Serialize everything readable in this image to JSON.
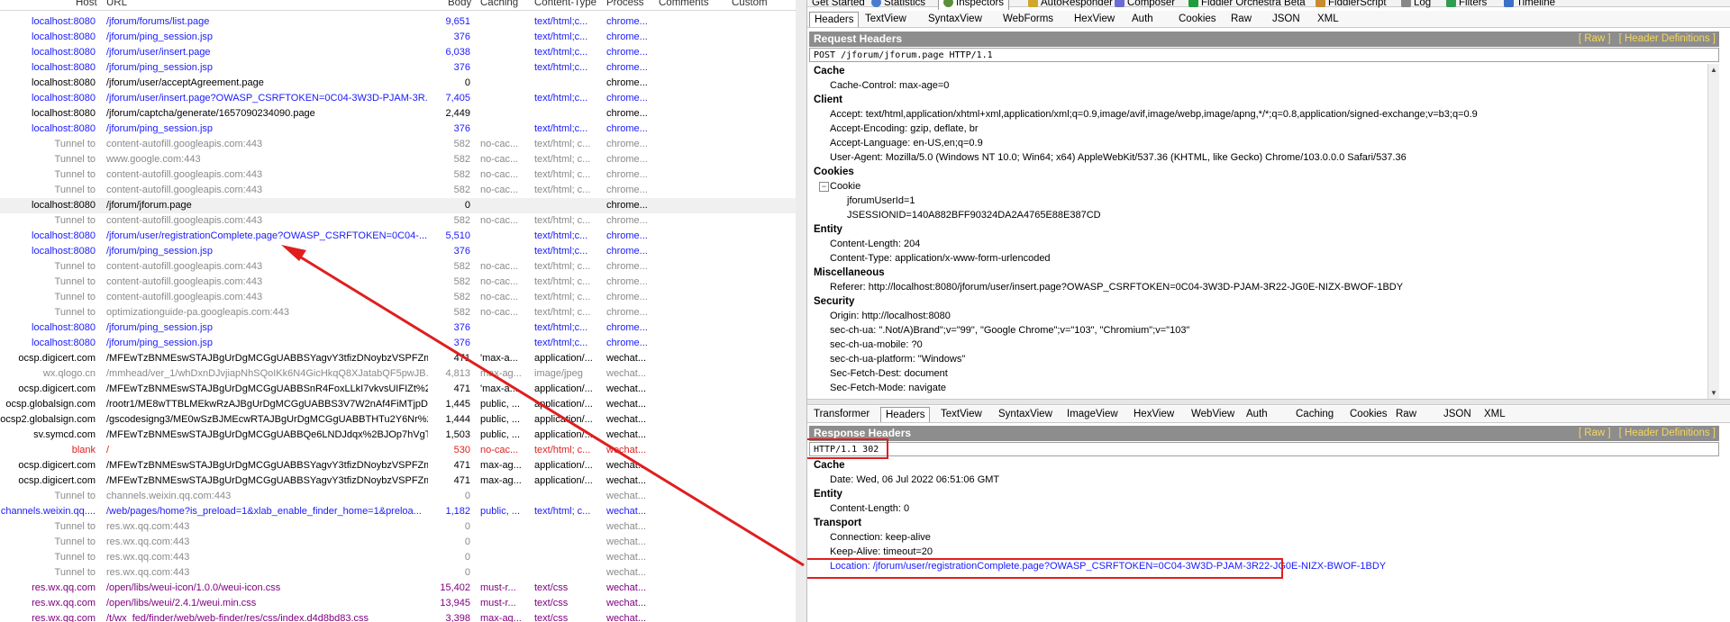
{
  "session_list": {
    "columns": {
      "host": "Host",
      "url": "URL",
      "body": "Body",
      "caching": "Caching",
      "content_type": "Content-Type",
      "process": "Process",
      "comments": "Comments",
      "custom": "Custom"
    },
    "rows": [
      {
        "host": "localhost:8080",
        "url": "/jforum/forums/list.page",
        "body": "9,651",
        "caching": "",
        "ctype": "text/html;c...",
        "process": "chrome...",
        "color": "#1a1aff"
      },
      {
        "host": "localhost:8080",
        "url": "/jforum/ping_session.jsp",
        "body": "376",
        "caching": "",
        "ctype": "text/html;c...",
        "process": "chrome...",
        "color": "#1a1aff"
      },
      {
        "host": "localhost:8080",
        "url": "/jforum/user/insert.page",
        "body": "6,038",
        "caching": "",
        "ctype": "text/html;c...",
        "process": "chrome...",
        "color": "#1a1aff"
      },
      {
        "host": "localhost:8080",
        "url": "/jforum/ping_session.jsp",
        "body": "376",
        "caching": "",
        "ctype": "text/html;c...",
        "process": "chrome...",
        "color": "#1a1aff"
      },
      {
        "host": "localhost:8080",
        "url": "/jforum/user/acceptAgreement.page",
        "body": "0",
        "caching": "",
        "ctype": "",
        "process": "chrome...",
        "color": "#000000"
      },
      {
        "host": "localhost:8080",
        "url": "/jforum/user/insert.page?OWASP_CSRFTOKEN=0C04-3W3D-PJAM-3R...",
        "body": "7,405",
        "caching": "",
        "ctype": "text/html;c...",
        "process": "chrome...",
        "color": "#1a1aff"
      },
      {
        "host": "localhost:8080",
        "url": "/jforum/captcha/generate/1657090234090.page",
        "body": "2,449",
        "caching": "",
        "ctype": "",
        "process": "chrome...",
        "color": "#000000"
      },
      {
        "host": "localhost:8080",
        "url": "/jforum/ping_session.jsp",
        "body": "376",
        "caching": "",
        "ctype": "text/html;c...",
        "process": "chrome...",
        "color": "#1a1aff"
      },
      {
        "host": "Tunnel to",
        "url": "content-autofill.googleapis.com:443",
        "body": "582",
        "caching": "no-cac...",
        "ctype": "text/html; c...",
        "process": "chrome...",
        "color": "#8a8a8a"
      },
      {
        "host": "Tunnel to",
        "url": "www.google.com:443",
        "body": "582",
        "caching": "no-cac...",
        "ctype": "text/html; c...",
        "process": "chrome...",
        "color": "#8a8a8a"
      },
      {
        "host": "Tunnel to",
        "url": "content-autofill.googleapis.com:443",
        "body": "582",
        "caching": "no-cac...",
        "ctype": "text/html; c...",
        "process": "chrome...",
        "color": "#8a8a8a"
      },
      {
        "host": "Tunnel to",
        "url": "content-autofill.googleapis.com:443",
        "body": "582",
        "caching": "no-cac...",
        "ctype": "text/html; c...",
        "process": "chrome...",
        "color": "#8a8a8a"
      },
      {
        "host": "localhost:8080",
        "url": "/jforum/jforum.page",
        "body": "0",
        "caching": "",
        "ctype": "",
        "process": "chrome...",
        "color": "#000000"
      },
      {
        "host": "Tunnel to",
        "url": "content-autofill.googleapis.com:443",
        "body": "582",
        "caching": "no-cac...",
        "ctype": "text/html; c...",
        "process": "chrome...",
        "color": "#8a8a8a"
      },
      {
        "host": "localhost:8080",
        "url": "/jforum/user/registrationComplete.page?OWASP_CSRFTOKEN=0C04-...",
        "body": "5,510",
        "caching": "",
        "ctype": "text/html;c...",
        "process": "chrome...",
        "color": "#1a1aff"
      },
      {
        "host": "localhost:8080",
        "url": "/jforum/ping_session.jsp",
        "body": "376",
        "caching": "",
        "ctype": "text/html;c...",
        "process": "chrome...",
        "color": "#1a1aff"
      },
      {
        "host": "Tunnel to",
        "url": "content-autofill.googleapis.com:443",
        "body": "582",
        "caching": "no-cac...",
        "ctype": "text/html; c...",
        "process": "chrome...",
        "color": "#8a8a8a"
      },
      {
        "host": "Tunnel to",
        "url": "content-autofill.googleapis.com:443",
        "body": "582",
        "caching": "no-cac...",
        "ctype": "text/html; c...",
        "process": "chrome...",
        "color": "#8a8a8a"
      },
      {
        "host": "Tunnel to",
        "url": "content-autofill.googleapis.com:443",
        "body": "582",
        "caching": "no-cac...",
        "ctype": "text/html; c...",
        "process": "chrome...",
        "color": "#8a8a8a"
      },
      {
        "host": "Tunnel to",
        "url": "optimizationguide-pa.googleapis.com:443",
        "body": "582",
        "caching": "no-cac...",
        "ctype": "text/html; c...",
        "process": "chrome...",
        "color": "#8a8a8a"
      },
      {
        "host": "localhost:8080",
        "url": "/jforum/ping_session.jsp",
        "body": "376",
        "caching": "",
        "ctype": "text/html;c...",
        "process": "chrome...",
        "color": "#1a1aff"
      },
      {
        "host": "localhost:8080",
        "url": "/jforum/ping_session.jsp",
        "body": "376",
        "caching": "",
        "ctype": "text/html;c...",
        "process": "chrome...",
        "color": "#1a1aff"
      },
      {
        "host": "ocsp.digicert.com",
        "url": "/MFEwTzBNMEswSTAJBgUrDgMCGgUABBSYagvY3tfizDNoybzVSPFZmS...",
        "body": "471",
        "caching": "'max-a...",
        "ctype": "application/...",
        "process": "wechat...",
        "color": "#000000"
      },
      {
        "host": "wx.qlogo.cn",
        "url": "/mmhead/ver_1/whDxnDJvjiapNhSQoIKk6N4GicHkqQ8XJatabQF5pwJB...",
        "body": "4,813",
        "caching": "max-ag...",
        "ctype": "image/jpeg",
        "process": "wechat...",
        "color": "#8a8a8a"
      },
      {
        "host": "ocsp.digicert.com",
        "url": "/MFEwTzBNMEswSTAJBgUrDgMCGgUABBSnR4FoxLLkI7vkvsUIFIZt%2B...",
        "body": "471",
        "caching": "'max-a...",
        "ctype": "application/...",
        "process": "wechat...",
        "color": "#000000"
      },
      {
        "host": "ocsp.globalsign.com",
        "url": "/rootr1/ME8wTTBLMEkwRzAJBgUrDgMCGgUABBS3V7W2nAf4FiMTjpDJ...",
        "body": "1,445",
        "caching": "public, ...",
        "ctype": "application/...",
        "process": "wechat...",
        "color": "#000000"
      },
      {
        "host": "ocsp2.globalsign.com",
        "url": "/gscodesigng3/ME0wSzBJMEcwRTAJBgUrDgMCGgUABBTHTu2Y6Nr%2...",
        "body": "1,444",
        "caching": "public, ...",
        "ctype": "application/...",
        "process": "wechat...",
        "color": "#000000"
      },
      {
        "host": "sv.symcd.com",
        "url": "/MFEwTzBNMEswSTAJBgUrDgMCGgUABBQe6LNDJdqx%2BJOp7hVgTe...",
        "body": "1,503",
        "caching": "public, ...",
        "ctype": "application/...",
        "process": "wechat...",
        "color": "#000000"
      },
      {
        "host": "blank",
        "url": "/",
        "body": "530",
        "caching": "no-cac...",
        "ctype": "text/html; c...",
        "process": "wechat...",
        "color": "#e01e1e"
      },
      {
        "host": "ocsp.digicert.com",
        "url": "/MFEwTzBNMEswSTAJBgUrDgMCGgUABBSYagvY3tfizDNoybzVSPFZmS...",
        "body": "471",
        "caching": "max-ag...",
        "ctype": "application/...",
        "process": "wechat...",
        "color": "#000000"
      },
      {
        "host": "ocsp.digicert.com",
        "url": "/MFEwTzBNMEswSTAJBgUrDgMCGgUABBSYagvY3tfizDNoybzVSPFZmS...",
        "body": "471",
        "caching": "max-ag...",
        "ctype": "application/...",
        "process": "wechat...",
        "color": "#000000"
      },
      {
        "host": "Tunnel to",
        "url": "channels.weixin.qq.com:443",
        "body": "0",
        "caching": "",
        "ctype": "",
        "process": "wechat...",
        "color": "#8a8a8a"
      },
      {
        "host": "channels.weixin.qq....",
        "url": "/web/pages/home?is_preload=1&xlab_enable_finder_home=1&preloa...",
        "body": "1,182",
        "caching": "public, ...",
        "ctype": "text/html; c...",
        "process": "wechat...",
        "color": "#1a1aff"
      },
      {
        "host": "Tunnel to",
        "url": "res.wx.qq.com:443",
        "body": "0",
        "caching": "",
        "ctype": "",
        "process": "wechat...",
        "color": "#8a8a8a"
      },
      {
        "host": "Tunnel to",
        "url": "res.wx.qq.com:443",
        "body": "0",
        "caching": "",
        "ctype": "",
        "process": "wechat...",
        "color": "#8a8a8a"
      },
      {
        "host": "Tunnel to",
        "url": "res.wx.qq.com:443",
        "body": "0",
        "caching": "",
        "ctype": "",
        "process": "wechat...",
        "color": "#8a8a8a"
      },
      {
        "host": "Tunnel to",
        "url": "res.wx.qq.com:443",
        "body": "0",
        "caching": "",
        "ctype": "",
        "process": "wechat...",
        "color": "#8a8a8a"
      },
      {
        "host": "res.wx.qq.com",
        "url": "/open/libs/weui-icon/1.0.0/weui-icon.css",
        "body": "15,402",
        "caching": "must-r...",
        "ctype": "text/css",
        "process": "wechat...",
        "color": "#800080"
      },
      {
        "host": "res.wx.qq.com",
        "url": "/open/libs/weui/2.4.1/weui.min.css",
        "body": "13,945",
        "caching": "must-r...",
        "ctype": "text/css",
        "process": "wechat...",
        "color": "#800080"
      },
      {
        "host": "res.wx.qq.com",
        "url": "/t/wx_fed/finder/web/web-finder/res/css/index.d4d8bd83.css",
        "body": "3,398",
        "caching": "max-ag...",
        "ctype": "text/css",
        "process": "wechat...",
        "color": "#800080"
      }
    ]
  },
  "main_tabs": [
    {
      "label": "Get Started",
      "icon": "none"
    },
    {
      "label": "Statistics",
      "icon": "statistics-icon"
    },
    {
      "label": "Inspectors",
      "icon": "inspectors-icon"
    },
    {
      "label": "AutoResponder",
      "icon": "autoresponder-icon"
    },
    {
      "label": "Composer",
      "icon": "composer-icon"
    },
    {
      "label": "Fiddler Orchestra Beta",
      "icon": "orchestra-icon"
    },
    {
      "label": "FiddlerScript",
      "icon": "script-icon"
    },
    {
      "label": "Log",
      "icon": "log-icon"
    },
    {
      "label": "Filters",
      "icon": "filters-icon"
    },
    {
      "label": "Timeline",
      "icon": "timeline-icon"
    }
  ],
  "request_tabs": [
    "Headers",
    "TextView",
    "SyntaxView",
    "WebForms",
    "HexView",
    "Auth",
    "Cookies",
    "Raw",
    "JSON",
    "XML"
  ],
  "response_tabs": [
    "Transformer",
    "Headers",
    "TextView",
    "SyntaxView",
    "ImageView",
    "HexView",
    "WebView",
    "Auth",
    "Caching",
    "Cookies",
    "Raw",
    "JSON",
    "XML"
  ],
  "request": {
    "title": "Request Headers",
    "raw_link": "[ Raw ]",
    "defs_link": "[ Header Definitions ]",
    "request_line": "POST /jforum/jforum.page HTTP/1.1",
    "groups": [
      {
        "name": "Cache",
        "items": [
          "Cache-Control: max-age=0"
        ]
      },
      {
        "name": "Client",
        "items": [
          "Accept: text/html,application/xhtml+xml,application/xml;q=0.9,image/avif,image/webp,image/apng,*/*;q=0.8,application/signed-exchange;v=b3;q=0.9",
          "Accept-Encoding: gzip, deflate, br",
          "Accept-Language: en-US,en;q=0.9",
          "User-Agent: Mozilla/5.0 (Windows NT 10.0; Win64; x64) AppleWebKit/537.36 (KHTML, like Gecko) Chrome/103.0.0.0 Safari/537.36"
        ]
      },
      {
        "name": "Cookies",
        "items": [
          "Cookie"
        ],
        "subitems": [
          "jforumUserId=1",
          "JSESSIONID=140A882BFF90324DA2A4765E88E387CD"
        ]
      },
      {
        "name": "Entity",
        "items": [
          "Content-Length: 204",
          "Content-Type: application/x-www-form-urlencoded"
        ]
      },
      {
        "name": "Miscellaneous",
        "items": [
          "Referer: http://localhost:8080/jforum/user/insert.page?OWASP_CSRFTOKEN=0C04-3W3D-PJAM-3R22-JG0E-NIZX-BWOF-1BDY"
        ]
      },
      {
        "name": "Security",
        "items": [
          "Origin: http://localhost:8080",
          "sec-ch-ua: \".Not/A)Brand\";v=\"99\", \"Google Chrome\";v=\"103\", \"Chromium\";v=\"103\"",
          "sec-ch-ua-mobile: ?0",
          "sec-ch-ua-platform: \"Windows\"",
          "Sec-Fetch-Dest: document",
          "Sec-Fetch-Mode: navigate"
        ]
      }
    ]
  },
  "response": {
    "title": "Response Headers",
    "raw_link": "[ Raw ]",
    "defs_link": "[ Header Definitions ]",
    "status_line": "HTTP/1.1 302",
    "groups": [
      {
        "name": "Cache",
        "items": [
          "Date: Wed, 06 Jul 2022 06:51:06 GMT"
        ]
      },
      {
        "name": "Entity",
        "items": [
          "Content-Length: 0"
        ]
      },
      {
        "name": "Transport",
        "items": [
          "Connection: keep-alive",
          "Keep-Alive: timeout=20"
        ]
      }
    ],
    "location": "Location: /jforum/user/registrationComplete.page?OWASP_CSRFTOKEN=0C04-3W3D-PJAM-3R22-JG0E-NIZX-BWOF-1BDY"
  },
  "colors": {
    "accent": "#e01e1e",
    "title_bar": "#8d8d8d",
    "link_yellow": "#f5d75a",
    "location_link": "#1a1aff"
  }
}
